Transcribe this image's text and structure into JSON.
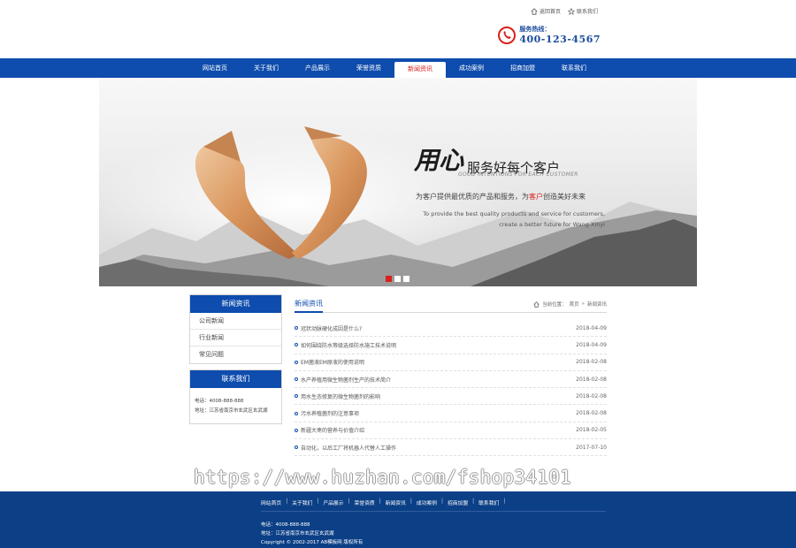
{
  "top_links": [
    {
      "label": "返回首页",
      "icon": "home-icon"
    },
    {
      "label": "联系我们",
      "icon": "star-icon"
    }
  ],
  "hotline": {
    "label": "服务热线：",
    "number": "400-123-4567",
    "icon": "phone-icon",
    "color": "#d9211d"
  },
  "nav": {
    "items": [
      "网站首页",
      "关于我们",
      "产品展示",
      "荣誉资质",
      "新闻资讯",
      "成功案例",
      "招商加盟",
      "联系我们"
    ],
    "active": "新闻资讯",
    "color": "#0e4cad"
  },
  "banner": {
    "calligraphy": "用心",
    "title": "服务好每个客户",
    "en_sub": "GOOD INTENTIONS FOR EACH CUSTOMER",
    "cn_pre": "为客户提供最优质的产品和服务，为",
    "cn_red": "客户",
    "cn_post": "创造美好未来",
    "en_line1": "To provide the best quality products and service for customers,",
    "en_line2": "create a better future for Wang Xinyi",
    "slides": 3,
    "active_slide": 1
  },
  "sidebar": {
    "news_title": "新闻资讯",
    "news_items": [
      "公司新闻",
      "行业新闻",
      "常见问题"
    ],
    "contact_title": "联系我们",
    "contact_phone": "电话：4008-888-888",
    "contact_address": "地址：江苏省南京市玄武区玄武湖"
  },
  "main": {
    "title": "新闻资讯",
    "crumb_prefix": "当前位置：",
    "crumb_home": "首页",
    "crumb_sep": "»",
    "crumb_current": "新闻资讯",
    "news": [
      {
        "title": "冠状动脉硬化成因是什么?",
        "date": "2018-04-09"
      },
      {
        "title": "如何围绕防水等级选择防水施工技术说明",
        "date": "2018-04-09"
      },
      {
        "title": "EM菌液EM原液的使用说明",
        "date": "2018-02-08"
      },
      {
        "title": "水产养殖用微生物菌剂生产的技术简介",
        "date": "2018-02-08"
      },
      {
        "title": "用水生态修复的微生物菌剂的影响",
        "date": "2018-02-08"
      },
      {
        "title": "污水养殖菌剂的注意事项",
        "date": "2018-02-08"
      },
      {
        "title": "新疆大枣的营养与价值介绍",
        "date": "2018-02-05"
      },
      {
        "title": "自动化，以后工厂将机器人代替人工操作",
        "date": "2017-07-10"
      }
    ]
  },
  "watermark": "https://www.huzhan.com/fshop34101",
  "footer": {
    "nav": [
      "网站首页",
      "关于我们",
      "产品展示",
      "荣誉资质",
      "新闻资讯",
      "成功案例",
      "招商加盟",
      "联系我们"
    ],
    "phone": "电话：4008-888-888",
    "address": "地址：江苏省南京市玄武区玄武湖",
    "copyright": "Copyright © 2002-2017 AB模板网 版权所有",
    "bg": "#0b3f86"
  }
}
